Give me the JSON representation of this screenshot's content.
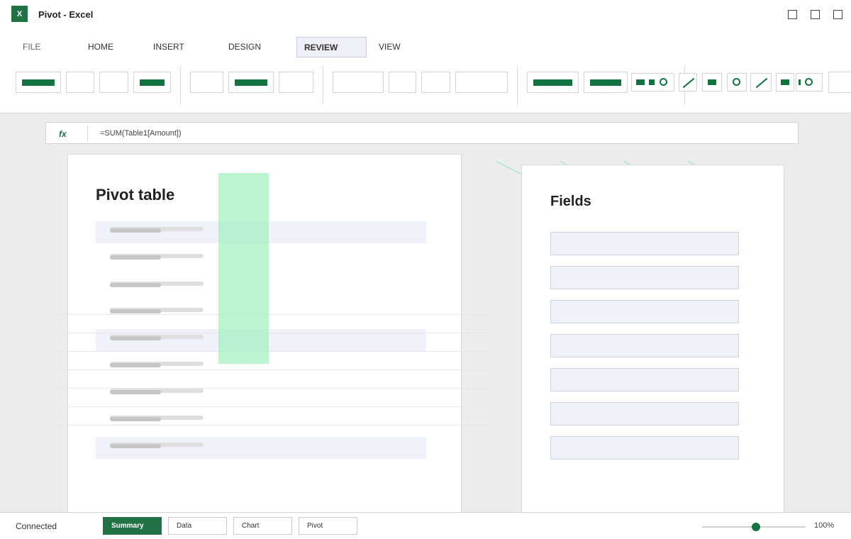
{
  "window": {
    "app_icon_letter": "X",
    "title": "Pivot - Excel"
  },
  "ribbon": {
    "tabs": [
      {
        "label": "FILE"
      },
      {
        "label": "HOME"
      },
      {
        "label": "INSERT"
      },
      {
        "label": "DESIGN"
      },
      {
        "label": "REVIEW"
      },
      {
        "label": "VIEW"
      }
    ],
    "active_tab": "REVIEW"
  },
  "formula_bar": {
    "fx_label": "fx",
    "formula": "=SUM(Table1[Amount])"
  },
  "pivot_panel": {
    "title": "Pivot table"
  },
  "fields_panel": {
    "title": "Fields"
  },
  "status_bar": {
    "status": "Connected",
    "sheet_tabs": [
      {
        "label": "Summary"
      },
      {
        "label": "Data"
      },
      {
        "label": "Chart"
      },
      {
        "label": "Pivot"
      }
    ],
    "active_sheet": "Summary",
    "zoom_label": "100%",
    "zoom_fraction": 0.5
  },
  "colors": {
    "accent": "#217346",
    "selection": "#a9f0c4",
    "row_highlight": "#eef1fa"
  }
}
